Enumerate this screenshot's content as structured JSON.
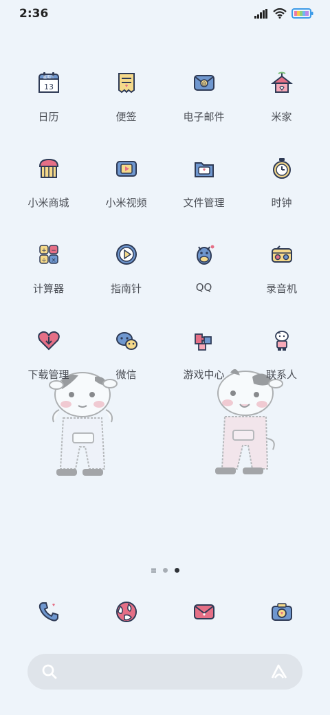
{
  "status": {
    "time": "2:36"
  },
  "apps": [
    {
      "label": "日历",
      "icon": "calendar-icon",
      "date_top": "星期三",
      "date_num": "13"
    },
    {
      "label": "便签",
      "icon": "notes-icon"
    },
    {
      "label": "电子邮件",
      "icon": "email-icon"
    },
    {
      "label": "米家",
      "icon": "mi-home-icon"
    },
    {
      "label": "小米商城",
      "icon": "mi-store-icon"
    },
    {
      "label": "小米视频",
      "icon": "mi-video-icon"
    },
    {
      "label": "文件管理",
      "icon": "file-manager-icon"
    },
    {
      "label": "时钟",
      "icon": "clock-icon"
    },
    {
      "label": "计算器",
      "icon": "calculator-icon"
    },
    {
      "label": "指南针",
      "icon": "compass-icon"
    },
    {
      "label": "QQ",
      "icon": "qq-icon"
    },
    {
      "label": "录音机",
      "icon": "recorder-icon"
    },
    {
      "label": "下载管理",
      "icon": "download-icon"
    },
    {
      "label": "微信",
      "icon": "wechat-icon"
    },
    {
      "label": "游戏中心",
      "icon": "game-center-icon"
    },
    {
      "label": "联系人",
      "icon": "contacts-icon"
    }
  ],
  "dock": [
    {
      "icon": "phone-icon"
    },
    {
      "icon": "browser-icon"
    },
    {
      "icon": "messages-icon"
    },
    {
      "icon": "camera-icon"
    }
  ],
  "pager": {
    "pages": 3,
    "active": 3
  },
  "colors": {
    "background": "#eef4fa",
    "accent_blue": "#6f97cf",
    "accent_pink": "#e56f86",
    "accent_yellow": "#f5d98a"
  }
}
